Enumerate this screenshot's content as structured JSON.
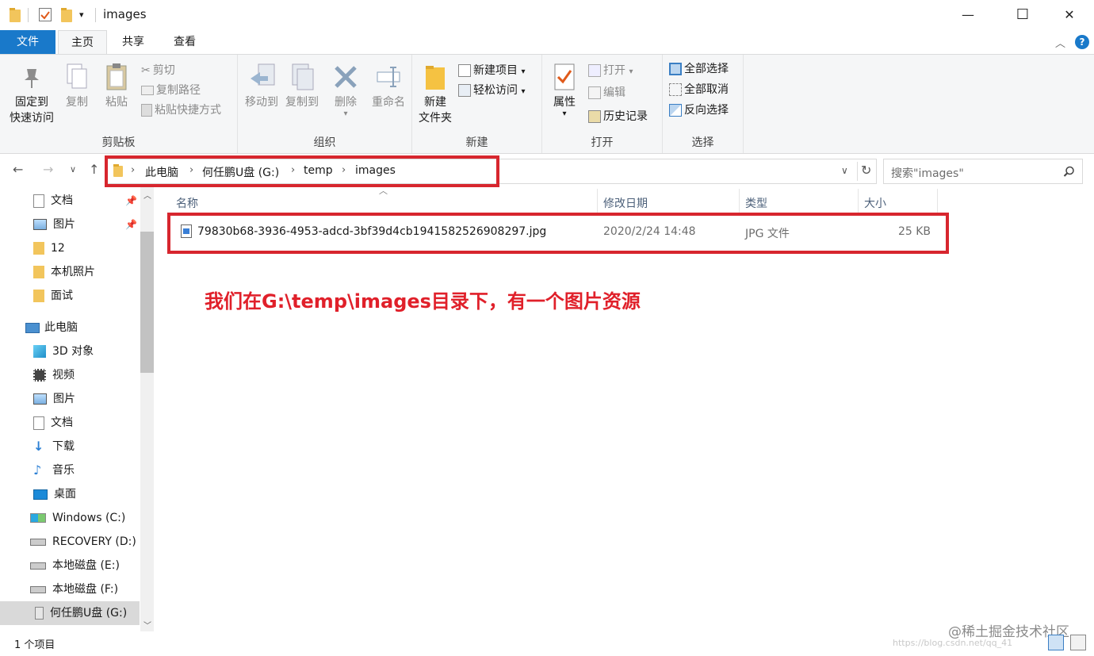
{
  "window": {
    "title": "images",
    "minimize_glyph": "—",
    "maximize_glyph": "☐",
    "close_glyph": "✕"
  },
  "ribbon_tabs": [
    "文件",
    "主页",
    "共享",
    "查看"
  ],
  "ribbon": {
    "clipboard": {
      "label": "剪贴板",
      "pin_line1": "固定到",
      "pin_line2": "快速访问",
      "copy": "复制",
      "paste": "粘贴",
      "cut": "剪切",
      "copy_path": "复制路径",
      "paste_shortcut": "粘贴快捷方式"
    },
    "organize": {
      "label": "组织",
      "move_to": "移动到",
      "copy_to": "复制到",
      "delete": "删除",
      "rename": "重命名"
    },
    "new": {
      "label": "新建",
      "new_folder_line1": "新建",
      "new_folder_line2": "文件夹",
      "new_item": "新建项目",
      "easy_access": "轻松访问"
    },
    "open": {
      "label": "打开",
      "properties": "属性",
      "open": "打开",
      "edit": "编辑",
      "history": "历史记录"
    },
    "select": {
      "label": "选择",
      "select_all": "全部选择",
      "select_none": "全部取消",
      "invert": "反向选择"
    }
  },
  "address": {
    "crumbs": [
      "此电脑",
      "何任鹏U盘 (G:)",
      "temp",
      "images"
    ]
  },
  "search": {
    "placeholder": "搜索\"images\""
  },
  "sidebar": {
    "quick_access": [
      {
        "label": "文档",
        "icon": "document-icon",
        "pinned": true
      },
      {
        "label": "图片",
        "icon": "picture-icon",
        "pinned": true
      },
      {
        "label": "12",
        "icon": "folder-icon",
        "pinned": false
      },
      {
        "label": "本机照片",
        "icon": "folder-icon",
        "pinned": false
      },
      {
        "label": "面试",
        "icon": "folder-icon",
        "pinned": false
      }
    ],
    "this_pc": "此电脑",
    "pc_items": [
      {
        "label": "3D 对象",
        "icon": "cube-icon"
      },
      {
        "label": "视频",
        "icon": "video-icon"
      },
      {
        "label": "图片",
        "icon": "picture-icon"
      },
      {
        "label": "文档",
        "icon": "document-icon"
      },
      {
        "label": "下载",
        "icon": "download-icon"
      },
      {
        "label": "音乐",
        "icon": "music-icon"
      },
      {
        "label": "桌面",
        "icon": "desktop-icon"
      },
      {
        "label": "Windows (C:)",
        "icon": "windows-drive-icon"
      },
      {
        "label": "RECOVERY (D:)",
        "icon": "drive-icon"
      },
      {
        "label": "本地磁盘 (E:)",
        "icon": "drive-icon"
      },
      {
        "label": "本地磁盘 (F:)",
        "icon": "drive-icon"
      },
      {
        "label": "何任鹏U盘 (G:)",
        "icon": "usb-drive-icon",
        "selected": true
      }
    ]
  },
  "columns": {
    "name": "名称",
    "modified": "修改日期",
    "type": "类型",
    "size": "大小"
  },
  "files": [
    {
      "name": "79830b68-3936-4953-adcd-3bf39d4cb1941582526908297.jpg",
      "modified": "2020/2/24 14:48",
      "type": "JPG 文件",
      "size": "25 KB"
    }
  ],
  "annotation": "我们在G:\\temp\\images目录下，有一个图片资源",
  "status": "1 个项目",
  "watermark": "@稀土掘金技术社区",
  "watermark_url": "https://blog.csdn.net/qq_41"
}
